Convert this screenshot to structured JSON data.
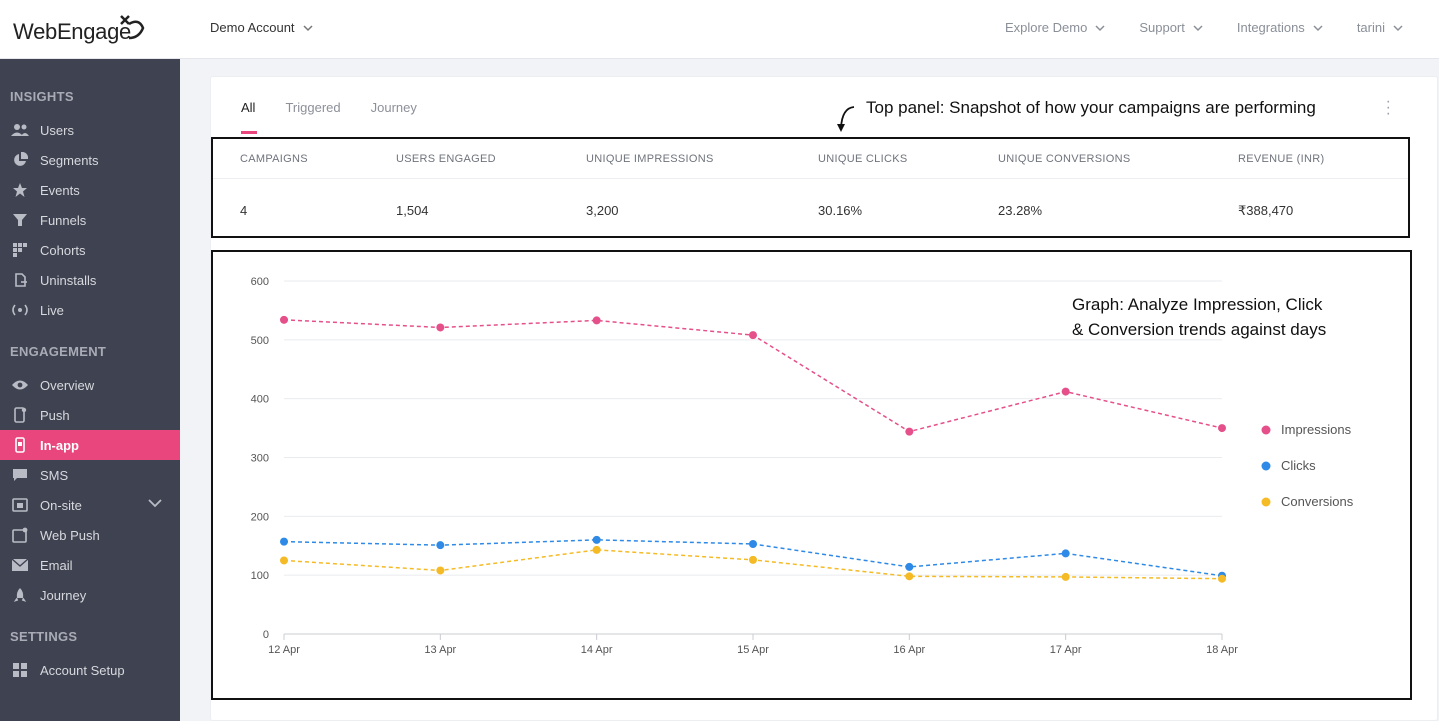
{
  "brand": {
    "logo_text": "WebEngage"
  },
  "header": {
    "account": "Demo Account",
    "nav": [
      "Explore Demo",
      "Support",
      "Integrations",
      "tarini"
    ]
  },
  "sidebar": {
    "insights_title": "INSIGHTS",
    "insights": [
      {
        "label": "Users",
        "icon": "users-icon"
      },
      {
        "label": "Segments",
        "icon": "pie-icon"
      },
      {
        "label": "Events",
        "icon": "star-icon"
      },
      {
        "label": "Funnels",
        "icon": "funnel-icon"
      },
      {
        "label": "Cohorts",
        "icon": "grid-icon"
      },
      {
        "label": "Uninstalls",
        "icon": "uninstall-icon"
      },
      {
        "label": "Live",
        "icon": "live-icon"
      }
    ],
    "engagement_title": "ENGAGEMENT",
    "engagement": [
      {
        "label": "Overview",
        "icon": "eye-icon"
      },
      {
        "label": "Push",
        "icon": "phone-icon"
      },
      {
        "label": "In-app",
        "icon": "inapp-icon"
      },
      {
        "label": "SMS",
        "icon": "sms-icon"
      },
      {
        "label": "On-site",
        "icon": "onsite-icon"
      },
      {
        "label": "Web Push",
        "icon": "webpush-icon"
      },
      {
        "label": "Email",
        "icon": "email-icon"
      },
      {
        "label": "Journey",
        "icon": "rocket-icon"
      }
    ],
    "settings_title": "SETTINGS",
    "settings": [
      {
        "label": "Account Setup",
        "icon": "apps-icon"
      }
    ],
    "active": "In-app",
    "accent": "#e8467c"
  },
  "tabs": [
    "All",
    "Triggered",
    "Journey"
  ],
  "active_tab": "All",
  "annotations": {
    "top": "Top panel: Snapshot of how your campaigns are performing",
    "graph_line1": "Graph: Analyze Impression, Click",
    "graph_line2": "& Conversion trends against days"
  },
  "metrics": {
    "headers": [
      "CAMPAIGNS",
      "USERS ENGAGED",
      "UNIQUE IMPRESSIONS",
      "UNIQUE CLICKS",
      "UNIQUE CONVERSIONS",
      "REVENUE (INR)"
    ],
    "values": [
      "4",
      "1,504",
      "3,200",
      "30.16%",
      "23.28%",
      "₹388,470"
    ]
  },
  "chart_data": {
    "type": "line",
    "x": [
      "12 Apr",
      "13 Apr",
      "14 Apr",
      "15 Apr",
      "16 Apr",
      "17 Apr",
      "18 Apr"
    ],
    "yticks": [
      0,
      100,
      200,
      300,
      400,
      500,
      600
    ],
    "ylim": [
      0,
      600
    ],
    "series": [
      {
        "name": "Impressions",
        "color": "#e5508a",
        "values": [
          534,
          521,
          533,
          508,
          344,
          412,
          350
        ]
      },
      {
        "name": "Clicks",
        "color": "#2e8ae6",
        "values": [
          157,
          151,
          160,
          153,
          114,
          137,
          99
        ]
      },
      {
        "name": "Conversions",
        "color": "#f4bb26",
        "values": [
          125,
          108,
          143,
          126,
          98,
          97,
          94
        ]
      }
    ],
    "grid": true,
    "legend": "right"
  }
}
